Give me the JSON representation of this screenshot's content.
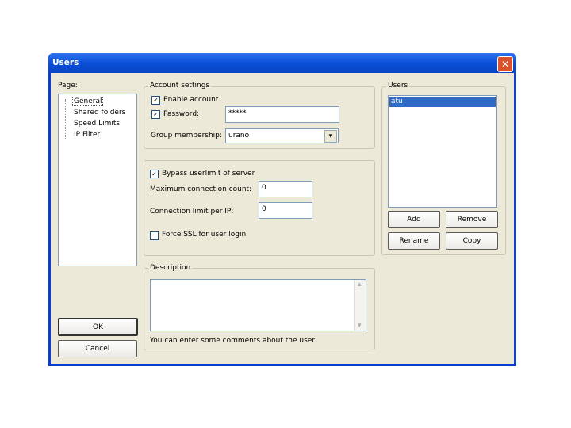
{
  "window": {
    "title": "Users",
    "close_glyph": "✕"
  },
  "page_tree": {
    "label": "Page:",
    "items": [
      "General",
      "Shared folders",
      "Speed Limits",
      "IP Filter"
    ]
  },
  "account": {
    "legend": "Account settings",
    "enable_label": "Enable account",
    "enable_checked": true,
    "password_label": "Password:",
    "password_checked": true,
    "password_value": "*****",
    "group_label": "Group membership:",
    "group_value": "urano"
  },
  "limits": {
    "bypass_label": "Bypass userlimit of server",
    "bypass_checked": true,
    "max_conn_label": "Maximum connection count:",
    "max_conn_value": "0",
    "conn_per_ip_label": "Connection limit per IP:",
    "conn_per_ip_value": "0",
    "force_ssl_label": "Force SSL for user login",
    "force_ssl_checked": false
  },
  "description": {
    "legend": "Description",
    "value": "",
    "hint": "You can enter some comments about the user"
  },
  "users": {
    "legend": "Users",
    "items": [
      "atu"
    ],
    "selected": "atu",
    "add_label": "Add",
    "remove_label": "Remove",
    "rename_label": "Rename",
    "copy_label": "Copy"
  },
  "footer": {
    "ok_label": "OK",
    "cancel_label": "Cancel"
  },
  "icons": {
    "check": "✓",
    "dropdown": "▾",
    "scroll_up": "▴",
    "scroll_down": "▾"
  },
  "colors": {
    "title_bar": "#0b4fd8",
    "selection": "#316ac5",
    "dialog_bg": "#ece9d8"
  }
}
